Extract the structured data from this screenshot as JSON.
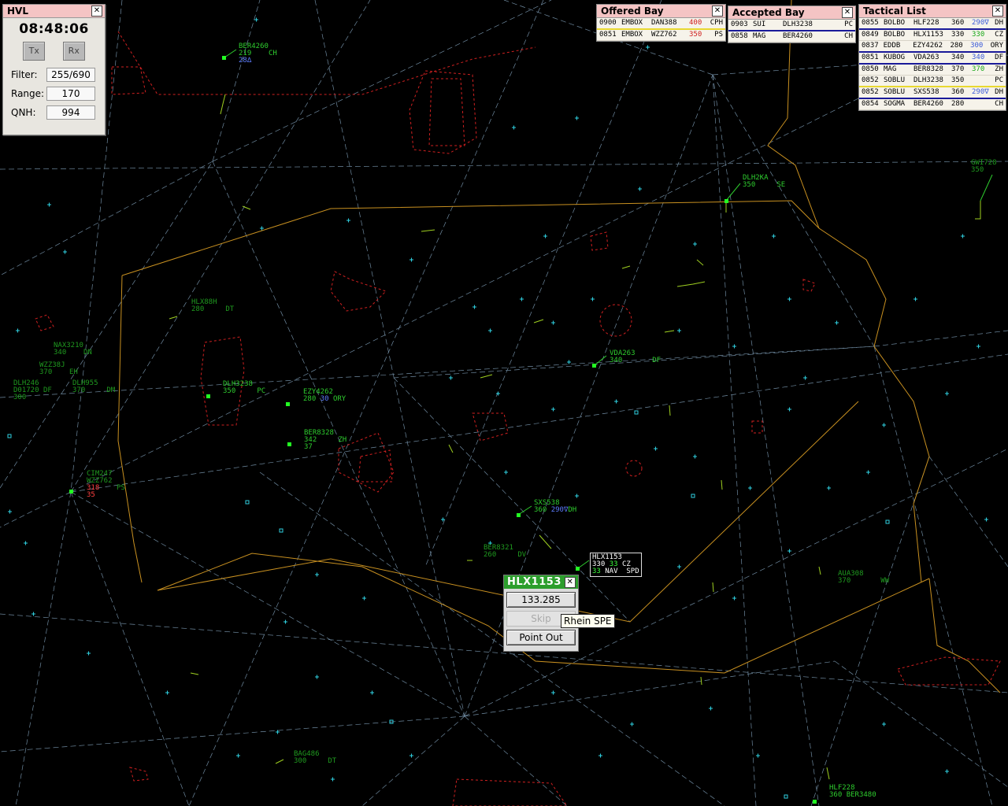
{
  "hvl": {
    "title": "HVL",
    "time": "08:48:06",
    "tx_label": "Tx",
    "rx_label": "Rx",
    "filter_label": "Filter:",
    "filter_value": "255/690",
    "range_label": "Range:",
    "range_value": "170",
    "qnh_label": "QNH:",
    "qnh_value": "994"
  },
  "offered_bay": {
    "title": "Offered Bay",
    "rows": [
      {
        "time": "0900",
        "point": "EMBOX",
        "callsign": "DAN388",
        "fl": "400",
        "dest": "CPH"
      },
      {
        "time": "0851",
        "point": "EMBOX",
        "callsign": "WZZ762",
        "fl": "350",
        "dest": "PS"
      }
    ]
  },
  "accepted_bay": {
    "title": "Accepted Bay",
    "rows": [
      {
        "time": "0903",
        "point": "SUI",
        "callsign": "DLH3238",
        "dest": "PC"
      },
      {
        "time": "0858",
        "point": "MAG",
        "callsign": "BER4260",
        "dest": "CH"
      }
    ]
  },
  "tactical_list": {
    "title": "Tactical List",
    "rows": [
      {
        "time": "0855",
        "point": "BOLBO",
        "callsign": "HLF228",
        "fl": "360",
        "xfl": "290∇",
        "dest": "DH"
      },
      {
        "time": "0849",
        "point": "BOLBO",
        "callsign": "HLX1153",
        "fl": "330",
        "xfl": "330",
        "dest": "CZ"
      },
      {
        "time": "0837",
        "point": "EDDB",
        "callsign": "EZY4262",
        "fl": "280",
        "xfl": "300",
        "dest": "ORY"
      },
      {
        "time": "0851",
        "point": "KUBOG",
        "callsign": "VDA263",
        "fl": "340",
        "xfl": "340",
        "dest": "DF"
      },
      {
        "time": "0850",
        "point": "MAG",
        "callsign": "BER8328",
        "fl": "370",
        "xfl": "370",
        "dest": "ZH"
      },
      {
        "time": "0852",
        "point": "SOBLU",
        "callsign": "DLH3238",
        "fl": "350",
        "xfl": "",
        "dest": "PC"
      },
      {
        "time": "0852",
        "point": "SOBLU",
        "callsign": "SXS538",
        "fl": "360",
        "xfl": "290∇",
        "dest": "DH"
      },
      {
        "time": "0854",
        "point": "SOGMA",
        "callsign": "BER4260",
        "fl": "280",
        "xfl": "",
        "dest": "CH"
      }
    ]
  },
  "popup": {
    "callsign": "HLX1153",
    "frequency": "133.285",
    "skip_label": "Skip",
    "point_out_label": "Point Out",
    "tooltip": "Rhein SPE"
  },
  "labels": {
    "ber4260": {
      "cs": "BER4260",
      "l2a": "219",
      "l2b": "CH",
      "l3": "28∆"
    },
    "dlh2ka": {
      "cs": "DLH2KA",
      "l2a": "350",
      "l2b": "SE"
    },
    "gwi728": {
      "cs": "GWI728",
      "l2": "350"
    },
    "hlx88h": {
      "cs": "HLX88H",
      "l2a": "280",
      "l2b": "DT"
    },
    "nax3210": {
      "cs": "NAX3210",
      "l2a": "340",
      "l2b": "DN"
    },
    "wzz38j": {
      "cs": "WZZ38J",
      "l2a": "370",
      "l2b": "EH"
    },
    "dlh246": {
      "cs": "DLH246",
      "l2": "300"
    },
    "dlh955": {
      "cs": "DLH955",
      "l2a": "370",
      "l2b": "DM"
    },
    "d1720": {
      "cs": "D01720",
      "l2": "DF"
    },
    "dlh3238": {
      "cs": "DLH3238",
      "l2a": "350",
      "l2b": "PC"
    },
    "ezy4262": {
      "cs": "EZY4262",
      "l2a": "280",
      "l2b": "30",
      "l2c": "ORY"
    },
    "vda263": {
      "cs": "VDA263",
      "l2a": "340",
      "l2b": "DF"
    },
    "ber8328": {
      "cs": "BER8328",
      "l2a": "342",
      "l2b": "ZH",
      "l3": "37"
    },
    "cim247": {
      "cs": "CIM247",
      "l2": "WZZ762",
      "l3a": "318",
      "l3b": "PS",
      "l4": "35"
    },
    "sxs538": {
      "cs": "SXS538",
      "l2a": "360",
      "l2b": "290∇",
      "l2c": "DH"
    },
    "ber8321": {
      "cs": "BER8321",
      "l2a": "260",
      "l2b": "DV"
    },
    "hlx1153": {
      "cs": "HLX1153",
      "l2a": "330",
      "l2b": "33",
      "l2c": "CZ",
      "l3a": "33",
      "l3b": "NAV",
      "l3c": "SPD"
    },
    "aua308": {
      "cs": "AUA308",
      "l2a": "370",
      "l2b": "WW"
    },
    "bag486": {
      "cs": "BAG486",
      "l2a": "300",
      "l2b": "DT"
    },
    "hlf228": {
      "cs": "HLF228",
      "l2": "360"
    },
    "ber3480": {
      "cs": "BER3480"
    }
  },
  "colors": {
    "background": "#000000",
    "airway": "#7a9ab0",
    "sector_boundary": "#d9a020",
    "restricted_area": "#d02020",
    "fix_marker": "#2fd0e0",
    "track_label": "#2ecc2e",
    "panel_title": "#f4c4c4",
    "popup_title": "#2c9e2c"
  }
}
